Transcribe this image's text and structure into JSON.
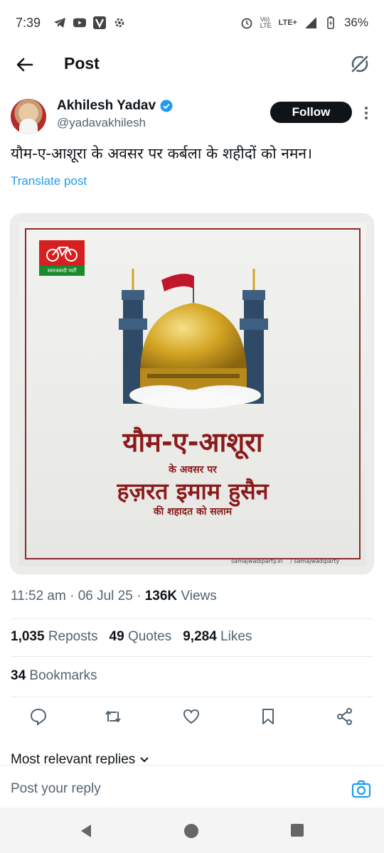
{
  "status_bar": {
    "time": "7:39",
    "battery": "36%",
    "network": "LTE+"
  },
  "header": {
    "title": "Post"
  },
  "author": {
    "name": "Akhilesh Yadav",
    "handle": "@yadavakhilesh",
    "follow_label": "Follow"
  },
  "post": {
    "text": "यौम-ए-आशूरा के अवसर पर कर्बला के शहीदों को नमन।",
    "translate_label": "Translate post"
  },
  "image": {
    "logo_text": "समाजवादी पार्टी",
    "line1": "यौम-ए-आशूरा",
    "line2": "के अवसर पर",
    "line3": "हज़रत इमाम हुसैन",
    "line4": "की शहादत को सलाम",
    "footer_web": "samajwadiparty.in",
    "footer_social": "/ samajwadiparty"
  },
  "meta": {
    "time": "11:52 am",
    "date": "06 Jul 25",
    "views_count": "136K",
    "views_label": "Views"
  },
  "stats": {
    "reposts_count": "1,035",
    "reposts_label": "Reposts",
    "quotes_count": "49",
    "quotes_label": "Quotes",
    "likes_count": "9,284",
    "likes_label": "Likes",
    "bookmarks_count": "34",
    "bookmarks_label": "Bookmarks"
  },
  "replies": {
    "sort_label": "Most relevant replies",
    "input_placeholder": "Post your reply"
  },
  "colors": {
    "accent": "#1d9bf0",
    "text": "#0f1419",
    "muted": "#536471",
    "poster_red": "#8b1a1a"
  }
}
